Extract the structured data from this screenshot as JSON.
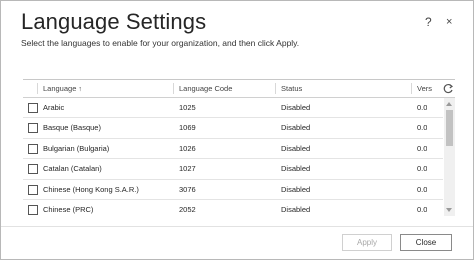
{
  "dialog": {
    "title": "Language Settings",
    "help_icon": "?",
    "close_icon": "×",
    "subtitle": "Select the languages to enable for your organization, and then click Apply."
  },
  "grid": {
    "columns": [
      {
        "label": "Language",
        "sort_indicator": "↑"
      },
      {
        "label": "Language Code"
      },
      {
        "label": "Status"
      },
      {
        "label": "Vers"
      }
    ],
    "refresh_icon": "refresh-icon",
    "rows": [
      {
        "language": "Arabic",
        "code": "1025",
        "status": "Disabled",
        "version": "0.0"
      },
      {
        "language": "Basque (Basque)",
        "code": "1069",
        "status": "Disabled",
        "version": "0.0"
      },
      {
        "language": "Bulgarian (Bulgaria)",
        "code": "1026",
        "status": "Disabled",
        "version": "0.0"
      },
      {
        "language": "Catalan (Catalan)",
        "code": "1027",
        "status": "Disabled",
        "version": "0.0"
      },
      {
        "language": "Chinese (Hong Kong S.A.R.)",
        "code": "3076",
        "status": "Disabled",
        "version": "0.0"
      },
      {
        "language": "Chinese (PRC)",
        "code": "2052",
        "status": "Disabled",
        "version": "0.0"
      }
    ]
  },
  "footer": {
    "apply_label": "Apply",
    "close_label": "Close"
  }
}
